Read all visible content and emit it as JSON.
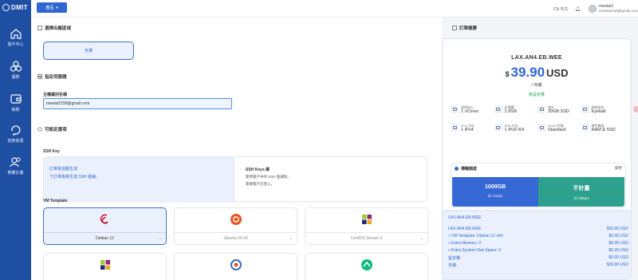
{
  "sidebar": {
    "logo": "DMIT",
    "items": [
      {
        "label": "客戶中心",
        "icon": "home-icon"
      },
      {
        "label": "服務",
        "icon": "cubes-icon"
      },
      {
        "label": "帳務",
        "icon": "wallet-icon"
      },
      {
        "label": "技術資源",
        "icon": "question-icon"
      },
      {
        "label": "推薦計畫",
        "icon": "users-icon"
      }
    ]
  },
  "topbar": {
    "button_label": "產品",
    "lang": "CN 中文",
    "user_name": "meetat1",
    "user_email": "meetat2158@gmail.com"
  },
  "main": {
    "region_title": "選擇出廠區域",
    "region_option": "全選",
    "server_title": "指定伺服器",
    "hostname_label": "主機識別名稱",
    "hostname_value": "meetat2158@gmail.com",
    "options_title": "可設定選項",
    "ssh_label": "SSH Key",
    "ssh_opt1_title": "訂單後自動生成",
    "ssh_opt1_desc": "下訂單後將生成 SSH 金鑰。",
    "ssh_opt2_title": "SSH Keys 庫",
    "ssh_opt2_desc1": "使用帳戶中的 SSH 金鑰對。",
    "ssh_opt2_desc2": "需要帳戶已登入。",
    "vm_label": "VM Template",
    "templates": [
      {
        "name": "Debian 12",
        "icon": "debian-icon"
      },
      {
        "name": "Ubuntu 24.04",
        "icon": "ubuntu-icon"
      },
      {
        "name": "CentOS Stream 9",
        "icon": "centos-icon"
      }
    ]
  },
  "summary": {
    "title": "訂單概要",
    "product": "LAX.AN4.EB.WEE",
    "currency_sign": "$",
    "price": "39.90",
    "price_unit": "USD",
    "period": "/ 年繳",
    "setup": "免設定費",
    "specs": [
      {
        "label": "處理核心",
        "value": "1 vCores"
      },
      {
        "label": "記憶體",
        "value": "1.0GB"
      },
      {
        "label": "儲存",
        "value": "20GB SSD"
      },
      {
        "label": "網路路由",
        "value": "Eyeball"
      },
      {
        "label": "IPv4 位址",
        "value": "1 IPv4"
      },
      {
        "label": "IPv6 位址",
        "value": "1 IPv6 /64"
      },
      {
        "label": "DDoS 防護",
        "value": "Standard"
      },
      {
        "label": "彈性擴展",
        "value": "RAM & SSD"
      }
    ],
    "bandwidth_title": "傳輸額度",
    "bandwidth_switch": "變更",
    "bw_a_big": "1000GB",
    "bw_a_small": "@ 1Gbps",
    "bw_b_big": "不計量",
    "bw_b_small": "@ 2Mbps"
  },
  "detail": {
    "head": "LAX.AN4.EB.WEE",
    "rows": [
      {
        "label": "LAX.AN4.EB.WEE",
        "value": "$39.90 USD"
      },
      {
        "label": "» VM Template: Debian 12 x64",
        "value": "$0.00 USD"
      },
      {
        "label": "» Extra Memory: 0",
        "value": "$0.00 USD"
      },
      {
        "label": "» Extra System Disk Space: 0",
        "value": "$0.00 USD"
      },
      {
        "label": "設定費:",
        "value": "$0.00 USD"
      },
      {
        "label": "年繳:",
        "value": "$39.90 USD"
      }
    ]
  }
}
